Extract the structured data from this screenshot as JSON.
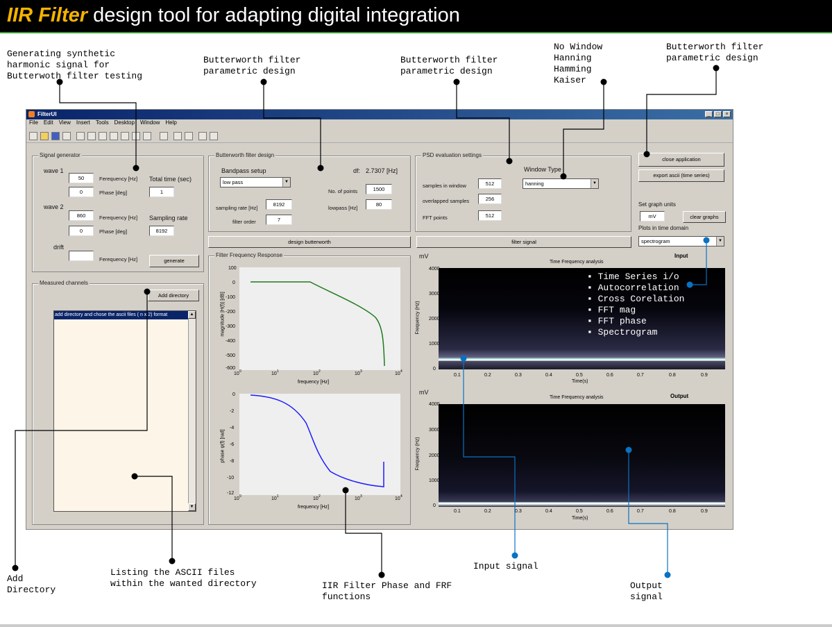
{
  "banner": {
    "title_em": "IIR Filter",
    "title_rest": " design tool for adapting digital integration"
  },
  "notes": {
    "synthetic": "Generating synthetic\nharmonic signal for\nButterwoth filter testing",
    "butter1": "Butterworth filter\nparametric design",
    "butter2": "Butterworth filter\nparametric design",
    "windows": "No Window\nHanning\nHamming\nKaiser",
    "butter3": "Butterworth filter\nparametric design",
    "add_dir": "Add\nDirectory",
    "listing": "Listing the ASCII files\nwithin the wanted directory",
    "iir_phase": "IIR Filter Phase and FRF\nfunctions",
    "input_signal": "Input signal",
    "output_signal": "Output\nsignal"
  },
  "window": {
    "title": "FilterUI",
    "menu": [
      "File",
      "Edit",
      "View",
      "Insert",
      "Tools",
      "Desktop",
      "Window",
      "Help"
    ]
  },
  "signal_gen": {
    "title": "Signal generator",
    "wave1": "wave 1",
    "wave2": "wave 2",
    "drift": "drift",
    "freq_label": "Ferequency [Hz]",
    "phase_label": "Phase [deg]",
    "w1_freq": "50",
    "w1_phase": "0",
    "w2_freq": "860",
    "w2_phase": "0",
    "drift_val": "",
    "total_time_label": "Total time (sec)",
    "total_time": "1",
    "sampling_label": "Sampling rate",
    "sampling": "8192",
    "generate": "generate"
  },
  "measured": {
    "title": "Measured channels",
    "add_dir": "Add directory",
    "list_item": "add directory and chose the ascii files ( n x 2) format"
  },
  "butter": {
    "title": "Butterworth filter design",
    "bandpass": "Bandpass setup",
    "type": "low pass",
    "df_label": "df:",
    "df_val": "2.7307 [Hz]",
    "npoints_label": "No. of points",
    "npoints": "1500",
    "lowpass_label": "lowpass [Hz]",
    "lowpass": "80",
    "srate_label": "sampling rate [Hz]",
    "srate": "8192",
    "order_label": "filter order",
    "order": "7",
    "design_btn": "design butterworth"
  },
  "psd": {
    "title": "PSD evaluation settings",
    "wintype_label": "Window Type",
    "wintype": "hanning",
    "sw_label": "samples in window",
    "sw": "512",
    "ov_label": "overlapped samples",
    "ov": "256",
    "fft_label": "FFT points",
    "fft": "512",
    "filter_btn": "filter signal"
  },
  "right": {
    "close": "close application",
    "export": "export ascii (time series)",
    "units_label": "Set graph units",
    "units": "mV",
    "clear": "clear graphs",
    "plots_label": "Plots in time domain",
    "plots": "spectrogram"
  },
  "ffr": {
    "title": "Filter Frequency Response",
    "mag_ylabel": "magnitude |H(f)| [dB]",
    "mag_yticks": [
      "100",
      "0",
      "-100",
      "-200",
      "-300",
      "-400",
      "-500",
      "-600"
    ],
    "phase_ylabel": "phase φ(f) [rad]",
    "phase_yticks": [
      "0",
      "-2",
      "-4",
      "-6",
      "-8",
      "-10",
      "-12"
    ],
    "xlabel": "frequency [Hz]",
    "xticks": [
      "10",
      "10",
      "10",
      "10",
      "10"
    ],
    "xexp": [
      "0",
      "1",
      "2",
      "3",
      "4"
    ]
  },
  "tf_input": {
    "unit": "mV",
    "title": "Time Frequency analysis",
    "label": "Input",
    "ylabel": "Frequency (Hz)",
    "xlabel": "Time(s)",
    "yticks": [
      "4000",
      "3000",
      "2000",
      "1000",
      "0"
    ],
    "xticks": [
      "0.1",
      "0.2",
      "0.3",
      "0.4",
      "0.5",
      "0.6",
      "0.7",
      "0.8",
      "0.9"
    ]
  },
  "tf_output": {
    "unit": "mV",
    "title": "Time Frequency analysis",
    "label": "Output",
    "ylabel": "Frequency (Hz)",
    "xlabel": "Time(s)",
    "yticks": [
      "4000",
      "3000",
      "2000",
      "1000",
      "0"
    ],
    "xticks": [
      "0.1",
      "0.2",
      "0.3",
      "0.4",
      "0.5",
      "0.6",
      "0.7",
      "0.8",
      "0.9"
    ]
  },
  "plot_menu": [
    "Time Series i/o",
    "Autocorrelation",
    "Cross Corelation",
    "FFT mag",
    "FFT phase",
    "Spectrogram"
  ]
}
